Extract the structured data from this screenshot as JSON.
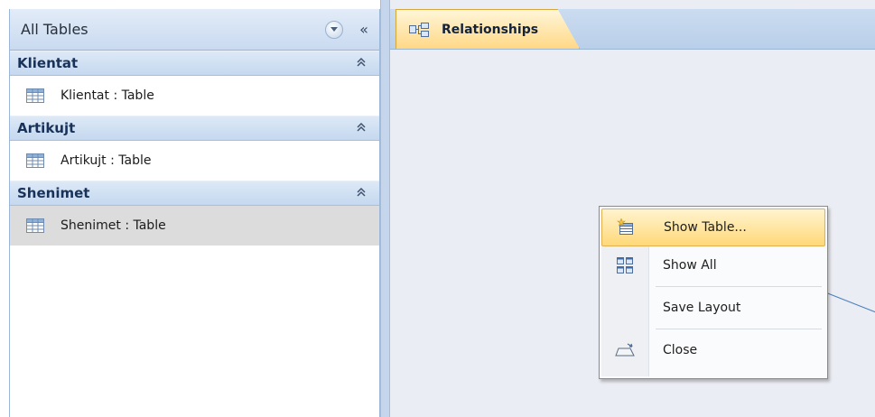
{
  "nav_pane": {
    "title": "All Tables",
    "dropdown_icon": "chevron-down-icon",
    "collapse_label": "«",
    "groups": [
      {
        "title": "Klientat",
        "chevron": "⌃",
        "items": [
          {
            "label": "Klientat : Table",
            "icon": "table-icon",
            "selected": false
          }
        ]
      },
      {
        "title": "Artikujt",
        "chevron": "⌃",
        "items": [
          {
            "label": "Artikujt : Table",
            "icon": "table-icon",
            "selected": false
          }
        ]
      },
      {
        "title": "Shenimet",
        "chevron": "⌃",
        "items": [
          {
            "label": "Shenimet : Table",
            "icon": "table-icon",
            "selected": true
          }
        ]
      }
    ]
  },
  "document": {
    "tab": {
      "label": "Relationships",
      "icon": "relationships-icon"
    }
  },
  "context_menu": {
    "items": [
      {
        "label": "Show Table...",
        "icon": "show-table-icon",
        "highlighted": true
      },
      {
        "label": "Show All",
        "icon": "show-all-icon",
        "highlighted": false
      },
      {
        "label": "Save Layout",
        "icon": "",
        "highlighted": false
      },
      {
        "label": "Close",
        "icon": "close-icon",
        "highlighted": false
      }
    ]
  },
  "colors": {
    "accent": "#ffd886",
    "nav_header": "#c9daf0",
    "workspace": "#eaedf3"
  }
}
